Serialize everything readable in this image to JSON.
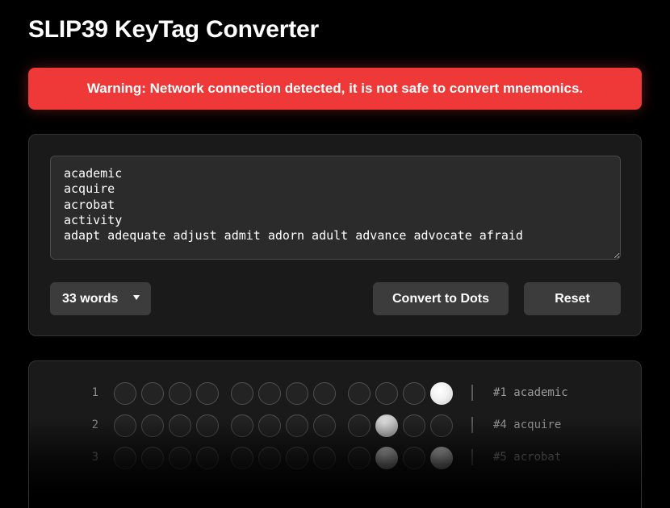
{
  "header": {
    "title": "SLIP39 KeyTag Converter"
  },
  "warning": {
    "text": "Warning: Network connection detected, it is not safe to convert mnemonics."
  },
  "input": {
    "mnemonic_value": "academic\nacquire\nacrobat\nactivity\nadapt adequate adjust admit adorn adult advance advocate afraid",
    "word_count_select": "33 words",
    "convert_label": "Convert to Dots",
    "reset_label": "Reset"
  },
  "output": {
    "rows": [
      {
        "index": "1",
        "word": "#1 academic",
        "dots": [
          0,
          0,
          0,
          0,
          0,
          0,
          0,
          0,
          0,
          0,
          0,
          1
        ]
      },
      {
        "index": "2",
        "word": "#4 acquire",
        "dots": [
          0,
          0,
          0,
          0,
          0,
          0,
          0,
          0,
          0,
          1,
          0,
          0
        ]
      },
      {
        "index": "3",
        "word": "#5 acrobat",
        "dots": [
          0,
          0,
          0,
          0,
          0,
          0,
          0,
          0,
          0,
          1,
          0,
          1
        ]
      }
    ]
  },
  "colors": {
    "warning_bg": "#ef3838",
    "card_bg": "#1a1a1a",
    "button_bg": "#3c3c3c"
  }
}
